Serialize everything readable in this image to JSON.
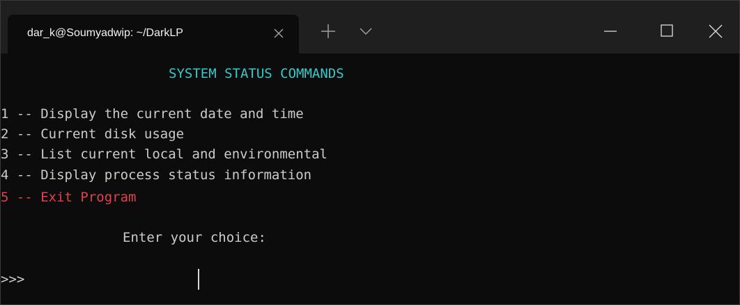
{
  "window": {
    "tab_title": "dar_k@Soumyadwip: ~/DarkLP",
    "icons": {
      "tab_close": "close-icon",
      "new_tab": "plus-icon",
      "dropdown": "chevron-down-icon",
      "minimize": "minimize-icon",
      "maximize": "maximize-icon",
      "close": "close-icon"
    }
  },
  "terminal": {
    "heading": "SYSTEM STATUS COMMANDS",
    "menu": [
      "1 -- Display the current date and time",
      "2 -- Current disk usage",
      "3 -- List current local and environmental",
      "4 -- Display process status information",
      "5 -- Exit Program"
    ],
    "prompt_text": "Enter your choice:",
    "input_prompt": ">>>"
  },
  "colors": {
    "background": "#0c0c0c",
    "text": "#cccccc",
    "heading": "#3ac8c8",
    "exit": "#e0424f"
  }
}
